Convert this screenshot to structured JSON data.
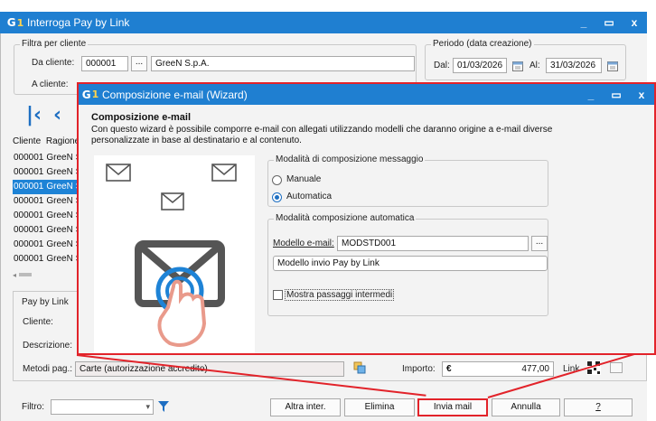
{
  "main": {
    "title": "Interroga Pay by Link",
    "window_controls": [
      "_",
      "▭",
      "x"
    ],
    "filter_group": {
      "legend": "Filtra per cliente",
      "da_cliente_label": "Da cliente:",
      "da_cliente_code": "000001",
      "da_cliente_dots": "...",
      "da_cliente_name": "GreeN S.p.A.",
      "a_cliente_label": "A cliente:"
    },
    "period_group": {
      "legend": "Periodo (data creazione)",
      "dal_label": "Dal:",
      "dal_value": "01/03/2026",
      "al_label": "Al:",
      "al_value": "31/03/2026"
    },
    "grid": {
      "headers": [
        "Cliente",
        "Ragione"
      ],
      "rows": [
        {
          "code": "000001",
          "name": "GreeN S",
          "selected": false
        },
        {
          "code": "000001",
          "name": "GreeN S",
          "selected": false
        },
        {
          "code": "000001",
          "name": "GreeN S",
          "selected": true
        },
        {
          "code": "000001",
          "name": "GreeN S",
          "selected": false
        },
        {
          "code": "000001",
          "name": "GreeN S",
          "selected": false
        },
        {
          "code": "000001",
          "name": "GreeN S",
          "selected": false
        },
        {
          "code": "000001",
          "name": "GreeN S",
          "selected": false
        },
        {
          "code": "000001",
          "name": "GreeN S",
          "selected": false
        }
      ]
    },
    "lower": {
      "tab": "Pay by Link",
      "cliente_label": "Cliente:",
      "descrizione_label": "Descrizione:",
      "metodi_label": "Metodi pag.:",
      "metodi_value": "Carte (autorizzazione accredito)",
      "importo_label": "Importo:",
      "currency_symbol": "€",
      "importo_value": "477,00",
      "link_label": "Link"
    },
    "bottom": {
      "filtro_label": "Filtro:",
      "buttons": [
        "Altra inter.",
        "Elimina",
        "Invia mail",
        "Annulla",
        "?"
      ]
    }
  },
  "dialog": {
    "title": "Composizione e-mail (Wizard)",
    "window_controls": [
      "_",
      "▭",
      "x"
    ],
    "heading": "Composizione e-mail",
    "description": "Con questo wizard è possibile comporre e-mail con allegati utilizzando modelli che daranno origine a e-mail diverse personalizzate in base al destinatario e al contenuto.",
    "mode_group": {
      "legend": "Modalità di composizione messaggio",
      "manuale": "Manuale",
      "automatica": "Automatica",
      "selected": "Automatica"
    },
    "auto_group": {
      "legend": "Modalità composizione automatica",
      "modello_label": "Modello e-mail:",
      "modello_value": "MODSTD001",
      "modello_dots": "...",
      "modello_desc": "Modello invio Pay by Link",
      "mostra_label": "Mostra passaggi intermedi",
      "mostra_checked": false
    }
  },
  "colors": {
    "titlebar": "#1f7fd1",
    "highlight_red": "#e2232a",
    "selection": "#1e83d6",
    "accent_blue": "#1e6fc2"
  }
}
